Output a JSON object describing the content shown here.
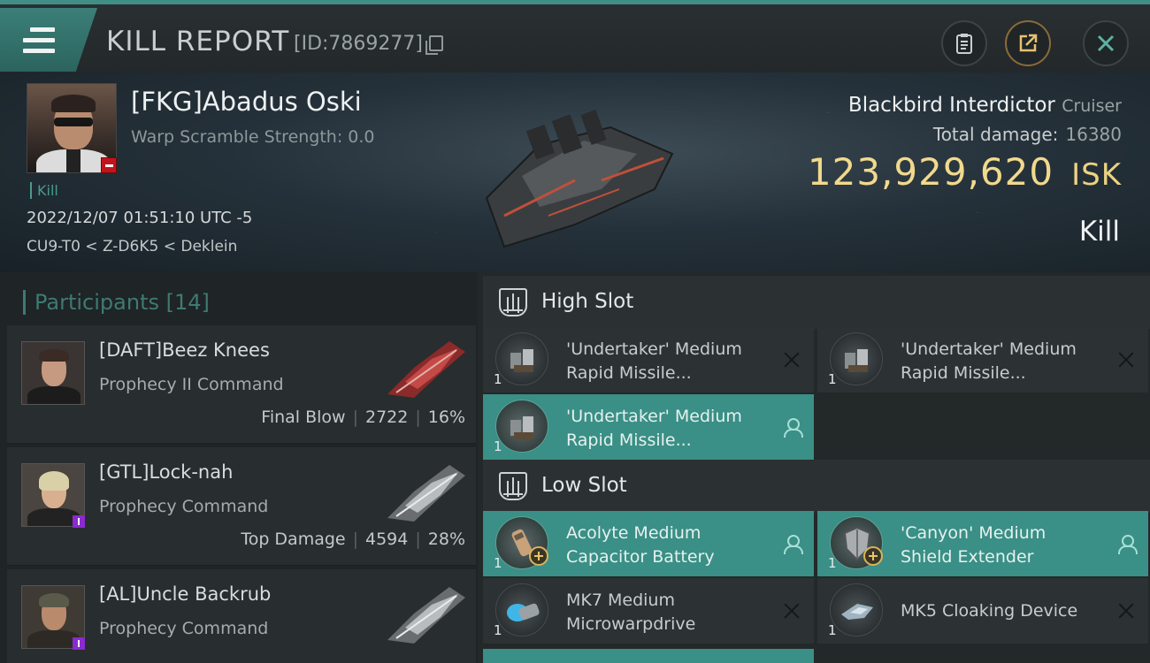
{
  "header": {
    "title": "KILL REPORT",
    "report_id": "[ID:7869277]",
    "menu_icon": "hamburger-icon",
    "buttons": [
      "clipboard-icon",
      "share-icon",
      "close-icon"
    ]
  },
  "victim": {
    "name": "[FKG]Abadus Oski",
    "warp_scramble": "Warp Scramble Strength: 0.0",
    "tag": "Kill",
    "time": "2022/12/07 01:51:10 UTC -5",
    "location": "CU9-T0 < Z-D6K5 < Deklein",
    "ship_name": "Blackbird Interdictor",
    "ship_class": "Cruiser",
    "total_damage_label": "Total damage:",
    "total_damage": "16380",
    "isk_value": "123,929,620",
    "isk_unit": "ISK",
    "result": "Kill"
  },
  "participants": {
    "label": "Participants",
    "count": "[14]",
    "rows": [
      {
        "name": "[DAFT]Beez Knees",
        "ship": "Prophecy II Command",
        "role": "Final Blow",
        "damage": "2722",
        "percent": "16%"
      },
      {
        "name": "[GTL]Lock-nah",
        "ship": "Prophecy Command",
        "role": "Top Damage",
        "damage": "4594",
        "percent": "28%"
      },
      {
        "name": "[AL]Uncle Backrub",
        "ship": "Prophecy Command"
      }
    ]
  },
  "fittings": {
    "high_slot": {
      "title": "High Slot",
      "modules": [
        {
          "line1": "'Undertaker' Medium",
          "line2": "Rapid Missile...",
          "qty": "1",
          "status": "destroyed"
        },
        {
          "line1": "'Undertaker' Medium",
          "line2": "Rapid Missile...",
          "qty": "1",
          "status": "destroyed"
        },
        {
          "line1": "'Undertaker' Medium",
          "line2": "Rapid Missile...",
          "qty": "1",
          "status": "dropped"
        }
      ]
    },
    "low_slot": {
      "title": "Low Slot",
      "modules": [
        {
          "line1": "Acolyte Medium",
          "line2": "Capacitor Battery",
          "qty": "1",
          "status": "dropped"
        },
        {
          "line1": "'Canyon' Medium",
          "line2": "Shield Extender",
          "qty": "1",
          "status": "dropped"
        },
        {
          "line1": "MK7 Medium",
          "line2": "Microwarpdrive",
          "qty": "1",
          "status": "destroyed"
        },
        {
          "line1": "MK5 Cloaking Device",
          "line2": "",
          "qty": "1",
          "status": "destroyed"
        }
      ]
    }
  },
  "colors": {
    "accent_teal": "#3a8f86",
    "isk_gold": "#f1d98d",
    "standing_red": "#c2151b",
    "badge_purple": "#8a2ad0"
  }
}
